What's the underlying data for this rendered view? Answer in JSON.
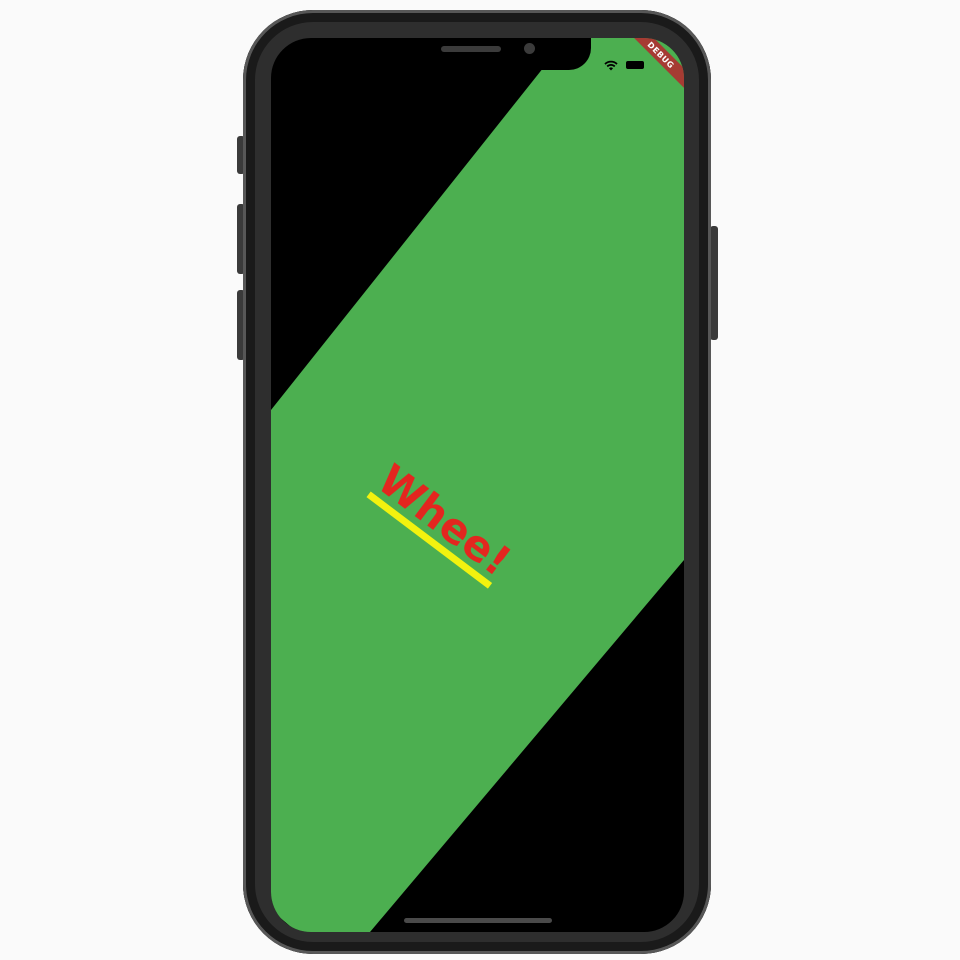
{
  "app": {
    "headline": "Whee!",
    "debug_label": "DEBUG"
  },
  "colors": {
    "background": "#000000",
    "band": "#4caf50",
    "headline_text": "#e3261f",
    "headline_underline": "#f2f20f",
    "debug_banner": "#a63b33",
    "phone_frame": "#2e2e2e"
  },
  "status_bar": {
    "icons": [
      "wifi-icon",
      "battery-icon"
    ]
  }
}
